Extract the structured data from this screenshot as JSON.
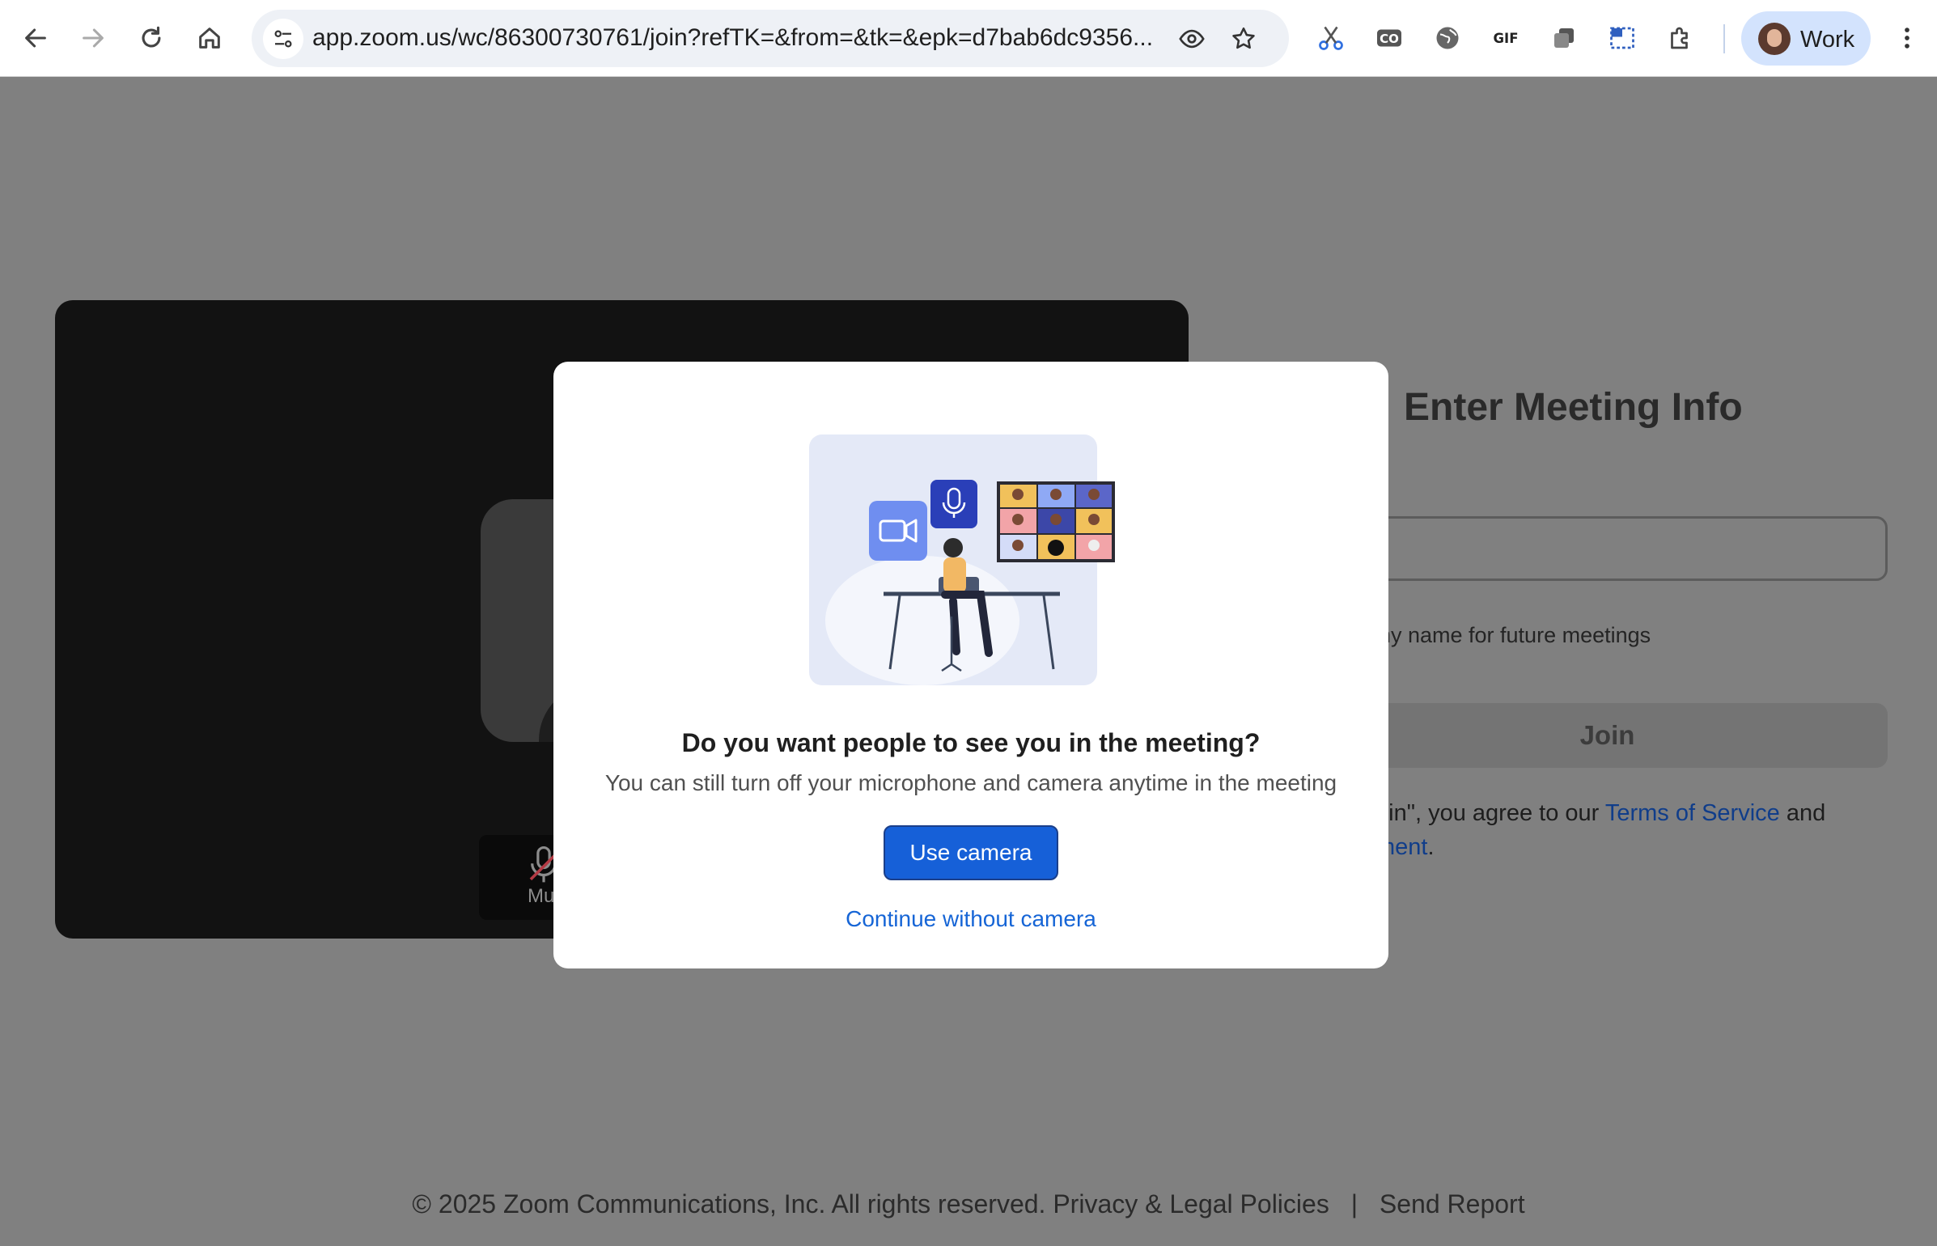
{
  "browser": {
    "url": "app.zoom.us/wc/86300730761/join?refTK=&from=&tk=&epk=d7bab6dc9356...",
    "profile_label": "Work",
    "nav_icons": [
      "back-icon",
      "forward-icon",
      "reload-icon",
      "home-icon"
    ],
    "extension_icons": [
      "scissors-icon",
      "co-icon",
      "globe-icon",
      "gif-icon",
      "copy-icon",
      "screenshot-icon",
      "puzzle-icon"
    ]
  },
  "page": {
    "preview": {
      "mute_label": "Mu"
    },
    "enter_title": "Enter Meeting Info",
    "name_input": {
      "value": "",
      "placeholder": ""
    },
    "remember_label": "r my name for future meetings",
    "join_label": "Join",
    "terms": {
      "prefix": "oin\", you agree to our ",
      "terms_link": "Terms of Service",
      "suffix": " and",
      "statement_link": "ment",
      "end": "."
    },
    "footer": {
      "copyright": "© 2025 Zoom Communications, Inc. All rights reserved.",
      "privacy_link": "Privacy & Legal Policies",
      "separator": "|",
      "report_link": "Send Report"
    }
  },
  "modal": {
    "title": "Do you want people to see you in the meeting?",
    "subtitle": "You can still turn off your microphone and camera anytime in the meeting",
    "primary_button": "Use camera",
    "secondary_link": "Continue without camera"
  },
  "colors": {
    "overlay": "#808080",
    "primary_blue": "#1660d8",
    "link_blue": "#1665d6",
    "profile_chip": "#d3e3fd"
  }
}
